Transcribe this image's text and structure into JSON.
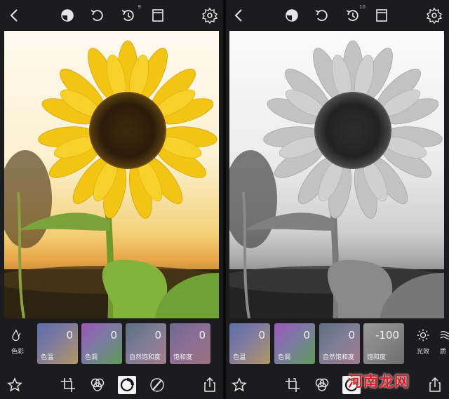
{
  "left": {
    "topbar": {
      "history_count": "9"
    },
    "left_tool": {
      "icon": "drop-icon",
      "label": "色彩"
    },
    "tiles": [
      {
        "name": "色温",
        "value": "0"
      },
      {
        "name": "色调",
        "value": "0"
      },
      {
        "name": "自然饱和度",
        "value": "0"
      },
      {
        "name": "饱和度",
        "value": "0"
      }
    ]
  },
  "right": {
    "topbar": {
      "history_count": "10"
    },
    "tiles": [
      {
        "name": "色温",
        "value": "0"
      },
      {
        "name": "色调",
        "value": "0"
      },
      {
        "name": "自然饱和度",
        "value": "0"
      },
      {
        "name": "饱和度",
        "value": "-100"
      }
    ],
    "right_tool": {
      "icon": "sun-icon",
      "label": "光效"
    },
    "cut_label": "质"
  },
  "watermark": "河南龙网",
  "colors": {
    "background": "#1c1c1e",
    "icon": "#e6e6e6",
    "accent_active": "#f4f4f4",
    "watermark": "#d0202a"
  }
}
